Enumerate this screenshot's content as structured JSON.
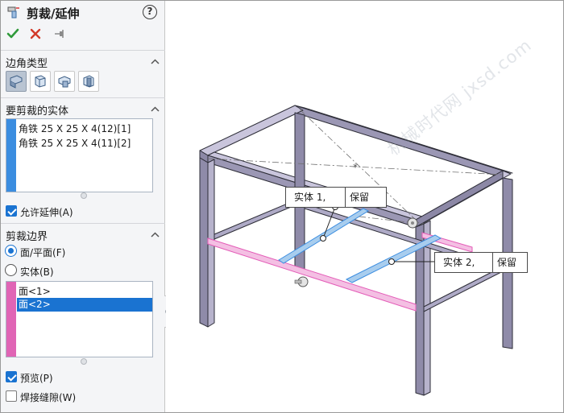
{
  "feature": {
    "title": "剪裁/延伸",
    "help_label": "?"
  },
  "actions": {
    "ok_icon": "checkmark-icon",
    "cancel_icon": "close-icon",
    "pin_icon": "pushpin-icon"
  },
  "corner_type": {
    "title": "边角类型",
    "options": [
      {
        "icon": "corner-end-trim-icon",
        "selected": true
      },
      {
        "icon": "corner-end-miter-icon",
        "selected": false
      },
      {
        "icon": "corner-end-butt1-icon",
        "selected": false
      },
      {
        "icon": "corner-end-butt2-icon",
        "selected": false
      }
    ]
  },
  "bodies_to_trim": {
    "title": "要剪裁的实体",
    "items": [
      "角铁 25 X 25 X 4(12)[1]",
      "角铁 25 X 25 X 4(11)[2]"
    ],
    "allow_extend_label": "允许延伸(A)",
    "allow_extend_checked": true
  },
  "trim_boundary": {
    "title": "剪裁边界",
    "radio_face_label": "面/平面(F)",
    "radio_body_label": "实体(B)",
    "selected": "face",
    "items": [
      "面<1>",
      "面<2>"
    ],
    "selected_index": 1
  },
  "options": {
    "preview_label": "预览(P)",
    "preview_checked": true,
    "weld_gap_label": "焊接缝隙(W)",
    "weld_gap_checked": false
  },
  "viewport": {
    "callout1": {
      "entity": "实体  1,",
      "action": "保留"
    },
    "callout2": {
      "entity": "实体  2,",
      "action": "保留"
    },
    "watermark": "机械时代网 jxsd.com"
  },
  "colors": {
    "accent_blue": "#1a73d1",
    "trim_body_stripe": "#3b8de0",
    "boundary_stripe": "#e065b5",
    "frame_steel": "#c7c4dc",
    "highlight_pink": "#f0a0d8",
    "highlight_blue": "#8fc0ea"
  }
}
